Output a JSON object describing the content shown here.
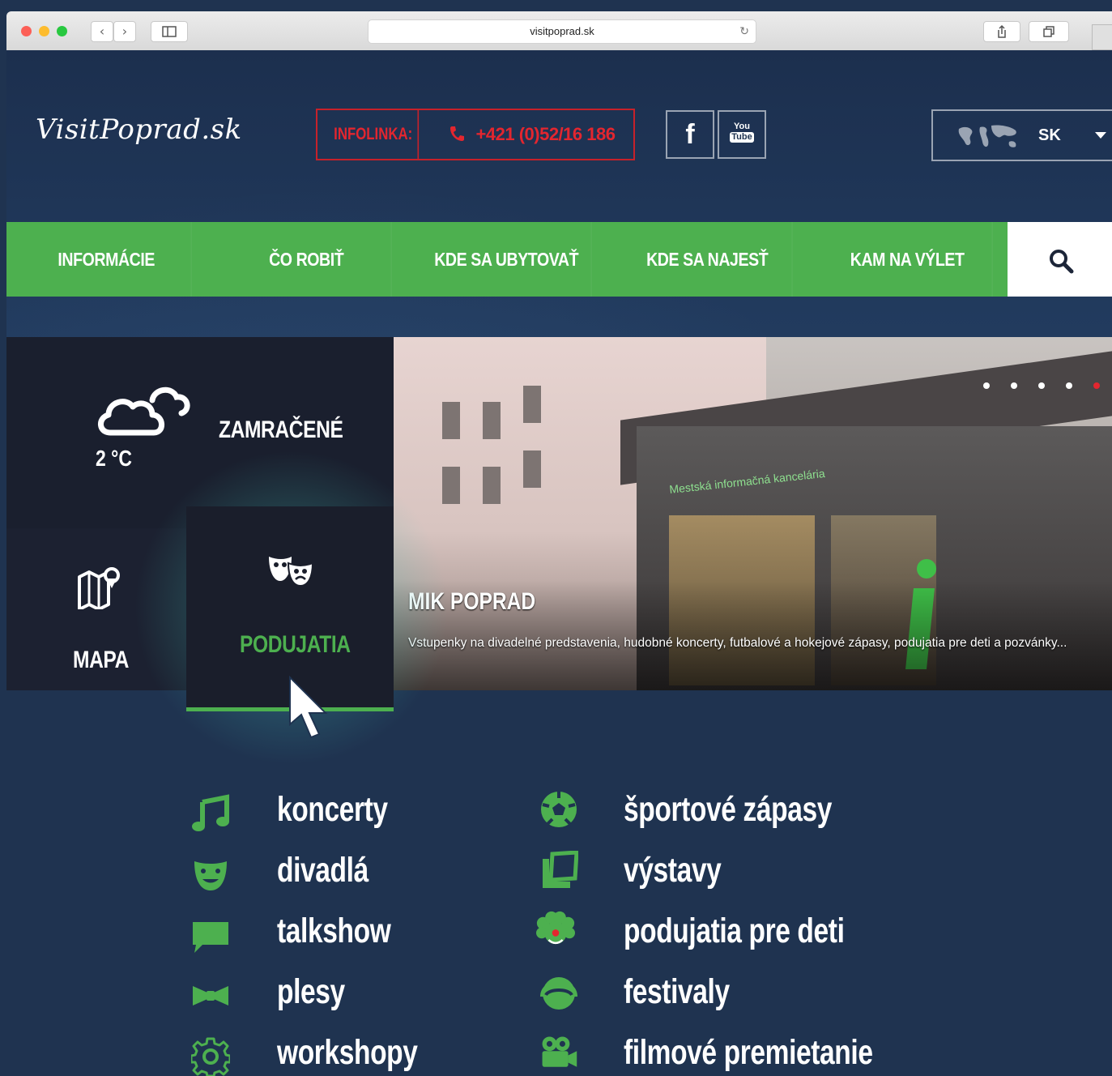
{
  "browser": {
    "url": "visitpoprad.sk",
    "back_label": "‹",
    "forward_label": "›",
    "reload_label": "↻"
  },
  "header": {
    "logo": "VisitPoprad.sk",
    "infoline_label": "INFOLINKA:",
    "infoline_phone": "+421 (0)52/16 186",
    "social": {
      "facebook": "f",
      "youtube_top": "You",
      "youtube_bottom": "Tube"
    },
    "language": "SK"
  },
  "nav": {
    "items": [
      "INFORMÁCIE",
      "ČO ROBIŤ",
      "KDE SA UBYTOVAŤ",
      "KDE SA NAJESŤ",
      "KAM NA VÝLET"
    ]
  },
  "tiles": {
    "weather": {
      "temperature": "2 °C",
      "condition": "ZAMRAČENÉ"
    },
    "map": {
      "label": "MAPA"
    },
    "events": {
      "label": "PODUJATIA"
    }
  },
  "slider": {
    "title": "MIK POPRAD",
    "text": "Vstupenky na divadelné predstavenia, hudobné koncerty, futbalové a hokejové zápasy, podujatia pre deti a pozvánky...",
    "sign_text": "Mestská informačná kancelária",
    "active_dot": 5,
    "dot_count": 5,
    "colors": {
      "active_dot": "#e3262f"
    }
  },
  "events_list": {
    "left": [
      {
        "label": "koncerty",
        "icon": "music-note-icon"
      },
      {
        "label": "divadlá",
        "icon": "theater-mask-icon"
      },
      {
        "label": "talkshow",
        "icon": "speech-bubble-icon"
      },
      {
        "label": "plesy",
        "icon": "bow-tie-icon"
      },
      {
        "label": "workshopy",
        "icon": "gear-icon"
      }
    ],
    "right": [
      {
        "label": "športové zápasy",
        "icon": "soccer-ball-icon"
      },
      {
        "label": "výstavy",
        "icon": "picture-frame-icon"
      },
      {
        "label": "podujatia pre deti",
        "icon": "clown-icon"
      },
      {
        "label": "festivaly",
        "icon": "headphones-icon"
      },
      {
        "label": "filmové premietanie",
        "icon": "film-camera-icon"
      }
    ]
  },
  "colors": {
    "accent_green": "#4db04f",
    "infoline_red": "#e3262f",
    "background_navy": "#1f3350"
  }
}
